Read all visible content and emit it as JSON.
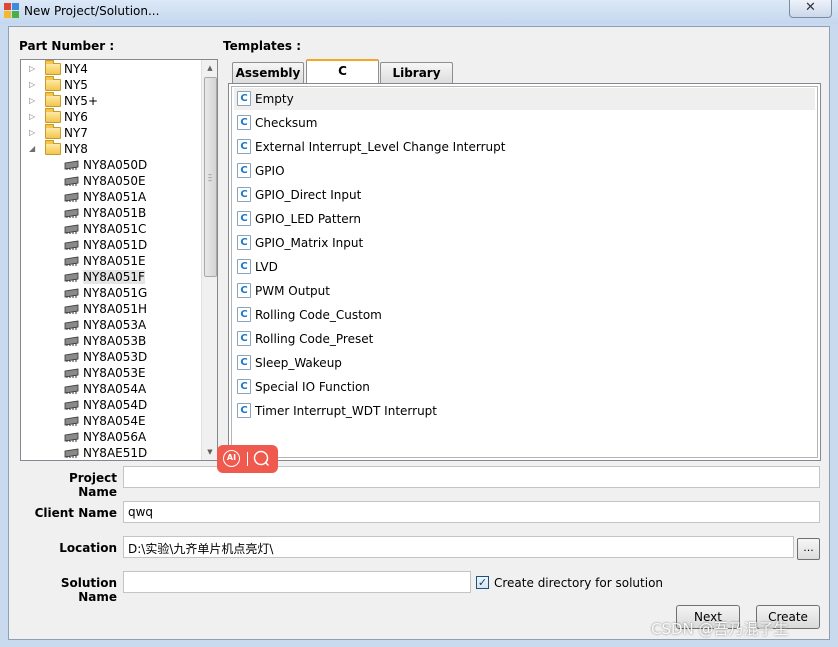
{
  "window": {
    "title": "New Project/Solution..."
  },
  "labels": {
    "part_number": "Part Number :",
    "templates": "Templates :"
  },
  "tree": {
    "folders": [
      {
        "label": "NY4",
        "expanded": false
      },
      {
        "label": "NY5",
        "expanded": false
      },
      {
        "label": "NY5+",
        "expanded": false
      },
      {
        "label": "NY6",
        "expanded": false
      },
      {
        "label": "NY7",
        "expanded": false
      },
      {
        "label": "NY8",
        "expanded": true
      }
    ],
    "parts": [
      "NY8A050D",
      "NY8A050E",
      "NY8A051A",
      "NY8A051B",
      "NY8A051C",
      "NY8A051D",
      "NY8A051E",
      "NY8A051F",
      "NY8A051G",
      "NY8A051H",
      "NY8A053A",
      "NY8A053B",
      "NY8A053D",
      "NY8A053E",
      "NY8A054A",
      "NY8A054D",
      "NY8A054E",
      "NY8A056A",
      "NY8AE51D"
    ],
    "selected_part": "NY8A051F"
  },
  "tabs": [
    {
      "label": "Assembly",
      "active": false
    },
    {
      "label": "C",
      "active": true
    },
    {
      "label": "Library",
      "active": false
    }
  ],
  "templates": [
    "Empty",
    "Checksum",
    "External Interrupt_Level Change Interrupt",
    "GPIO",
    "GPIO_Direct Input",
    "GPIO_LED Pattern",
    "GPIO_Matrix Input",
    "LVD",
    "PWM Output",
    "Rolling Code_Custom",
    "Rolling Code_Preset",
    "Sleep_Wakeup",
    "Special IO Function",
    "Timer Interrupt_WDT Interrupt"
  ],
  "template_icon": "C",
  "form": {
    "project_name_label": "Project Name",
    "project_name_value": "",
    "client_name_label": "Client Name",
    "client_name_value": "qwq",
    "location_label": "Location",
    "location_value": "D:\\实验\\九齐单片机点亮灯\\",
    "browse_label": "...",
    "solution_name_label": "Solution Name",
    "solution_name_value": "",
    "create_dir_label": "Create directory for solution",
    "create_dir_checked": true
  },
  "buttons": {
    "next": "Next",
    "create": "Create"
  },
  "overlay": {
    "ai_label": "AI"
  },
  "watermark": "CSDN @吾乃混子生",
  "colors": {
    "tab_accent": "#f5a623",
    "c_icon": "#1a78c8",
    "ai_badge": "#f05a4e"
  }
}
